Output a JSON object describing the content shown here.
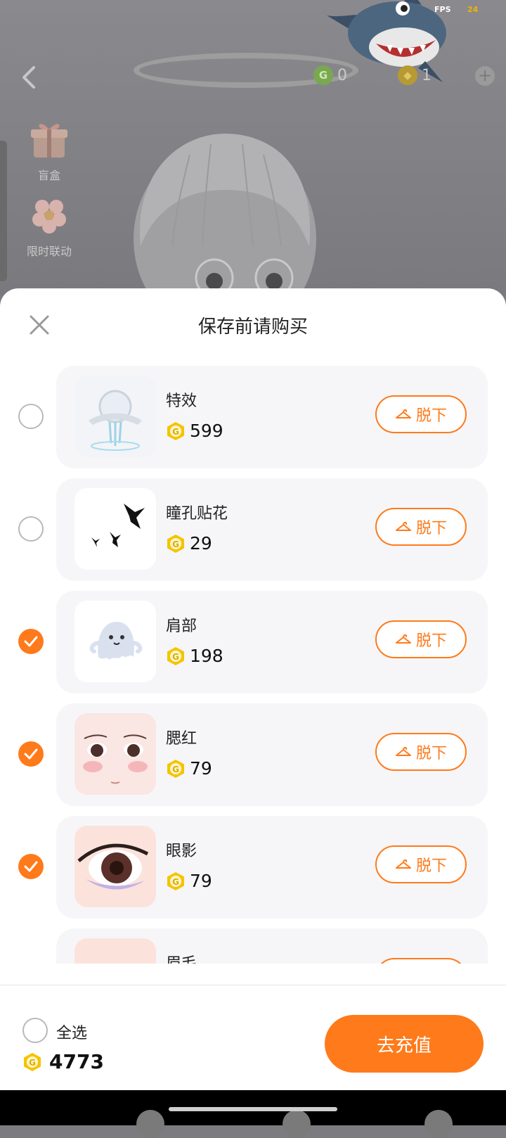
{
  "hud": {
    "fps_label": "FPS",
    "fps_value": "24",
    "coins_green": "0",
    "coins_gold": "1"
  },
  "side": {
    "blind_box": "盲盒",
    "limited": "限时联动"
  },
  "sheet": {
    "title": "保存前请购买",
    "items": [
      {
        "name": "特效",
        "price": "599",
        "checked": false,
        "remove_label": "脱下"
      },
      {
        "name": "瞳孔贴花",
        "price": "29",
        "checked": false,
        "remove_label": "脱下"
      },
      {
        "name": "肩部",
        "price": "198",
        "checked": true,
        "remove_label": "脱下"
      },
      {
        "name": "腮红",
        "price": "79",
        "checked": true,
        "remove_label": "脱下"
      },
      {
        "name": "眼影",
        "price": "79",
        "checked": true,
        "remove_label": "脱下"
      },
      {
        "name": "眉毛",
        "price": "",
        "checked": true,
        "remove_label": "脱下"
      }
    ]
  },
  "footer": {
    "select_all": "全选",
    "balance": "4773",
    "recharge": "去充值"
  },
  "colors": {
    "accent": "#ff7a1a",
    "coin": "#f5c400"
  }
}
